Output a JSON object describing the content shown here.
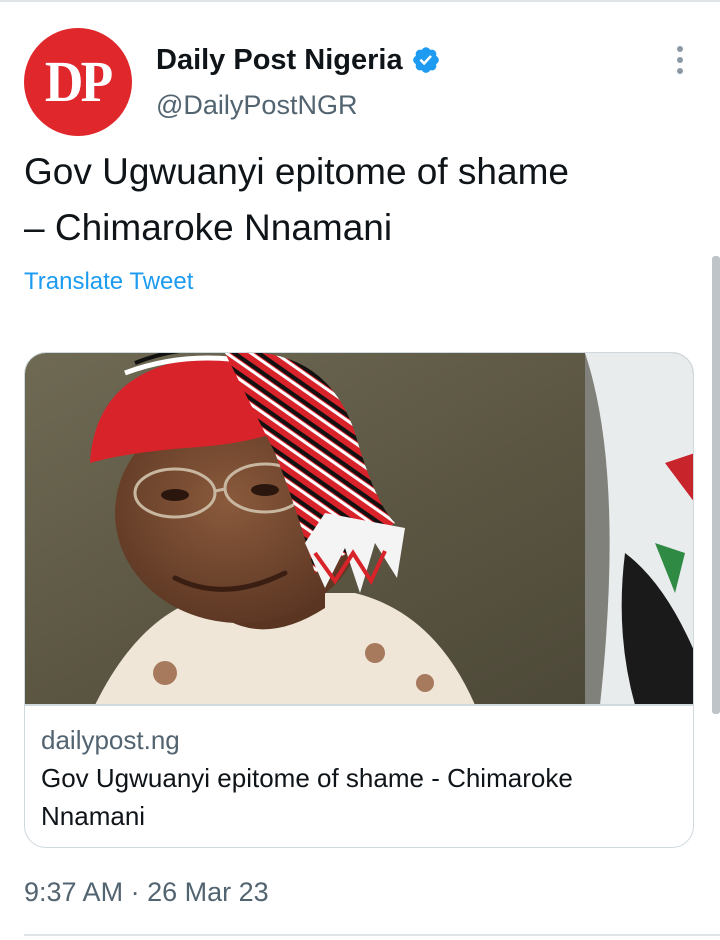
{
  "tweet": {
    "avatar_text": "DP",
    "display_name": "Daily Post Nigeria",
    "handle": "@DailyPostNGR",
    "text": "Gov Ugwuanyi epitome of shame\n– Chimaroke Nnamani",
    "translate_label": "Translate Tweet",
    "time": "9:37 AM",
    "separator": "·",
    "date": "26 Mar 23"
  },
  "card": {
    "domain": "dailypost.ng",
    "title": "Gov Ugwuanyi epitome of shame - Chimaroke Nnamani"
  },
  "icons": {
    "verified": "verified-badge-icon",
    "more": "more-options-icon"
  },
  "colors": {
    "brand_red": "#e0272c",
    "link_blue": "#1d9bf0",
    "verified_blue": "#1d9bf0",
    "secondary_text": "#536471",
    "primary_text": "#0f1419"
  }
}
